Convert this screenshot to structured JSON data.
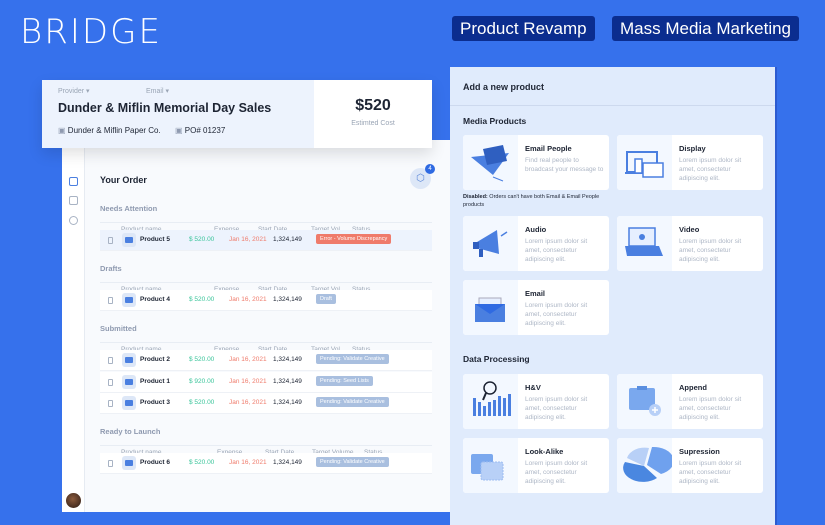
{
  "brand": "BRIDGE",
  "tags": [
    "Product Revamp",
    "Mass Media Marketing"
  ],
  "header": {
    "provider_label": "Provider",
    "email_label": "Email",
    "title": "Dunder & Miflin Memorial Day Sales",
    "company": "Dunder & Miflin Paper Co.",
    "po": "PO# 01237",
    "cost": "$520",
    "cost_label": "Estimted Cost"
  },
  "order": {
    "title": "Your Order",
    "cart_count": "4",
    "sections": [
      {
        "title": "Needs Attention",
        "headers": [
          "Product name",
          "Expense",
          "Start Date",
          "Target Vol.",
          "Status"
        ],
        "rows": [
          {
            "name": "Product 5",
            "expense": "$ 520.00",
            "date": "Jan 16, 2021",
            "volume": "1,324,149",
            "status": "Error - Volume Discrepancy",
            "status_color": "#ef7b6b",
            "highlight": true
          }
        ]
      },
      {
        "title": "Drafts",
        "headers": [
          "Product name",
          "Expense",
          "Start Date",
          "Target Vol.",
          "Status"
        ],
        "rows": [
          {
            "name": "Product 4",
            "expense": "$ 520.00",
            "date": "Jan 16, 2021",
            "volume": "1,324,149",
            "status": "Draft",
            "status_color": "#a9bfdf"
          }
        ]
      },
      {
        "title": "Submitted",
        "headers": [
          "Product name",
          "Expense",
          "Start Date",
          "Target Vol.",
          "Status"
        ],
        "rows": [
          {
            "name": "Product 2",
            "expense": "$ 520.00",
            "date": "Jan 16, 2021",
            "volume": "1,324,149",
            "status": "Pending: Validate Creative",
            "status_color": "#a9bfdf"
          },
          {
            "name": "Product 1",
            "expense": "$ 920.00",
            "date": "Jan 16, 2021",
            "volume": "1,324,149",
            "status": "Pending: Seed Lists",
            "status_color": "#a9bfdf"
          },
          {
            "name": "Product 3",
            "expense": "$ 520.00",
            "date": "Jan 16, 2021",
            "volume": "1,324,149",
            "status": "Pending: Validate Creative",
            "status_color": "#a9bfdf"
          }
        ]
      },
      {
        "title": "Ready to Launch",
        "headers": [
          "Product name",
          "Expense",
          "Start Date",
          "Target Volume",
          "Status"
        ],
        "rows": [
          {
            "name": "Product 6",
            "expense": "$ 520.00",
            "date": "Jan 16, 2021",
            "volume": "1,324,149",
            "status": "Pending: Validate Creative",
            "status_color": "#a9bfdf"
          }
        ]
      }
    ]
  },
  "panel": {
    "title": "Add a new product",
    "media_title": "Media Products",
    "media": [
      {
        "title": "Email People",
        "desc": "Find real people to broadcast your message to",
        "icon": "paper-plane-icon"
      },
      {
        "title": "Display",
        "desc": "Lorem ipsum dolor sit amet, consectetur adipiscing elit.",
        "icon": "devices-icon"
      },
      {
        "title": "Audio",
        "desc": "Lorem ipsum dolor sit amet, consectetur adipiscing elit.",
        "icon": "megaphone-icon"
      },
      {
        "title": "Video",
        "desc": "Lorem ipsum dolor sit amet, consectetur adipiscing elit.",
        "icon": "laptop-video-icon"
      },
      {
        "title": "Email",
        "desc": "Lorem ipsum dolor sit amet, consectetur adipiscing elit.",
        "icon": "envelope-icon"
      }
    ],
    "note_bold": "Disabled:",
    "note": " Orders can't have both Email & Email People products",
    "data_title": "Data Processing",
    "data": [
      {
        "title": "H&V",
        "desc": "Lorem ipsum dolor sit amet, consectetur adipiscing elit.",
        "icon": "bar-magnifier-icon"
      },
      {
        "title": "Append",
        "desc": "Lorem ipsum dolor sit amet, consectetur adipiscing elit.",
        "icon": "folder-plus-icon"
      },
      {
        "title": "Look-Alike",
        "desc": "Lorem ipsum dolor sit amet, consectetur adipiscing elit.",
        "icon": "folders-icon"
      },
      {
        "title": "Supression",
        "desc": "Lorem ipsum dolor sit amet, consectetur adipiscing elit.",
        "icon": "pie-chart-icon"
      }
    ]
  }
}
